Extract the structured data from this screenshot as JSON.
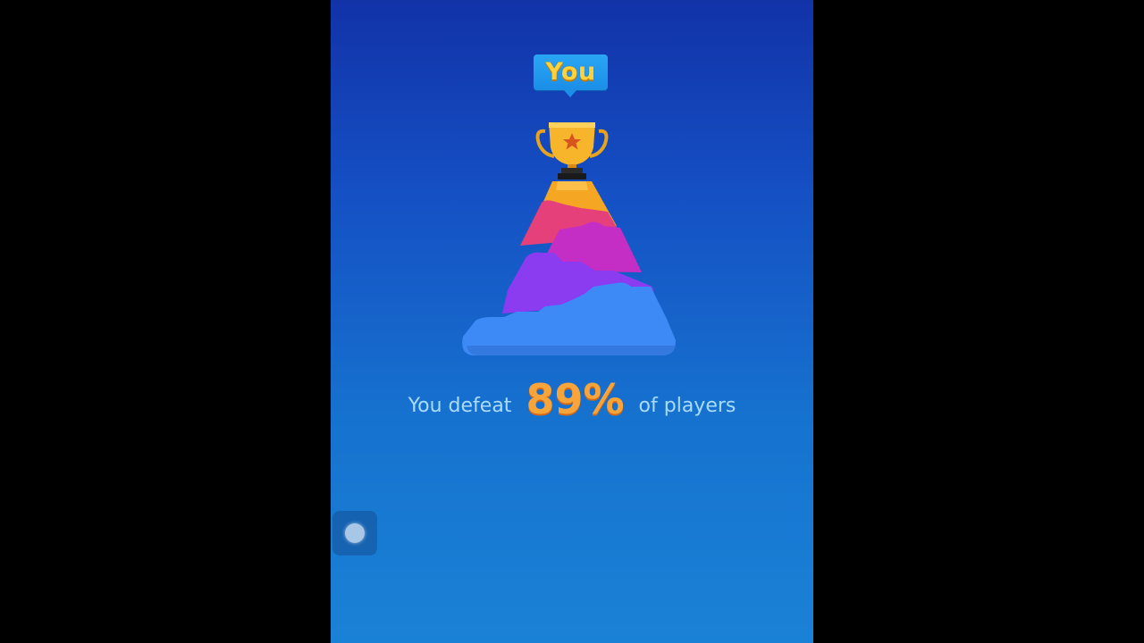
{
  "badge": {
    "label": "You"
  },
  "result": {
    "prefix": "You defeat",
    "percent": "89%",
    "suffix": "of players"
  },
  "pyramid": {
    "icon": "trophy-on-pyramid",
    "layers": [
      "gold",
      "pink",
      "magenta",
      "purple",
      "blue"
    ]
  },
  "colors": {
    "background_top": "#1232a8",
    "background_bottom": "#1a82d6",
    "badge_bg": "#1b8ee8",
    "badge_text": "#ffd23c",
    "percent_text": "#f7a53a",
    "label_text": "#a9dcff",
    "layer_gold": "#f5a623",
    "layer_pink": "#e6407a",
    "layer_magenta": "#c42ec4",
    "layer_purple": "#8b3cf0",
    "layer_blue": "#3d8af7"
  }
}
